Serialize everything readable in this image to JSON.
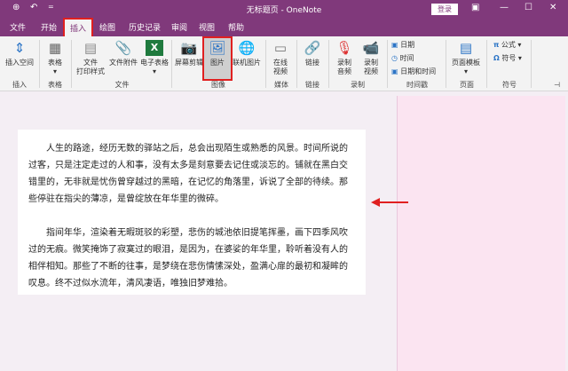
{
  "window": {
    "title": "无标题页 - OneNote",
    "login": "登录"
  },
  "tabs": [
    "文件",
    "开始",
    "插入",
    "绘图",
    "历史记录",
    "审阅",
    "视图",
    "帮助"
  ],
  "active_tab": "插入",
  "ribbon": {
    "buttons": {
      "insert_space": "插入空间",
      "table": "表格",
      "file_printout": "文件\n打印样式",
      "file_attachment": "文件附件",
      "spreadsheet": "电子表格",
      "screen_clipping": "屏幕剪辑",
      "pictures": "图片",
      "online_pictures": "联机图片",
      "online_video": "在线\n视频",
      "link": "链接",
      "record_audio": "录制\n音频",
      "record_video": "录制\n视频",
      "date": "日期",
      "time": "时间",
      "date_time": "日期和时间",
      "page_templates": "页面模板",
      "equation": "公式",
      "symbol": "符号"
    },
    "groups": {
      "insert": "插入",
      "tables": "表格",
      "files": "文件",
      "images": "图像",
      "media": "媒体",
      "links": "链接",
      "recording": "录制",
      "timestamp": "时间戳",
      "pages": "页面",
      "symbols": "符号"
    }
  },
  "note": {
    "paragraphs": [
      "人生的路途，经历无数的驿站之后，总会出现陌生或熟悉的风景。时间所说的过客，只是注定走过的人和事，没有太多是刻意要去记住或淡忘的。铺就在黑白交错里的，无非就是忧伤曾穿越过的黑暗，在记忆的角落里，诉说了全部的待续。那些停驻在指尖的薄凉，是曾绽放在年华里的微碎。",
      "指间年华，渲染着无暇斑驳的彩塑，悲伤的城池依旧提笔挥墨，画下四季风吹过的无痕。微笑掩饰了寂寞过的眼泪，是因为，在婆娑的年华里，聆听着没有人的相伴相知。那些了不断的往事，是梦绕在悲伤情愫深处，盈满心扉的最初和凝眸的叹息。终不过似水流年，清风凄语，唯独旧梦难拾。"
    ]
  },
  "colors": {
    "brand": "#80397b",
    "highlight": "#e02020",
    "side_pane": "#fbe4f1"
  }
}
